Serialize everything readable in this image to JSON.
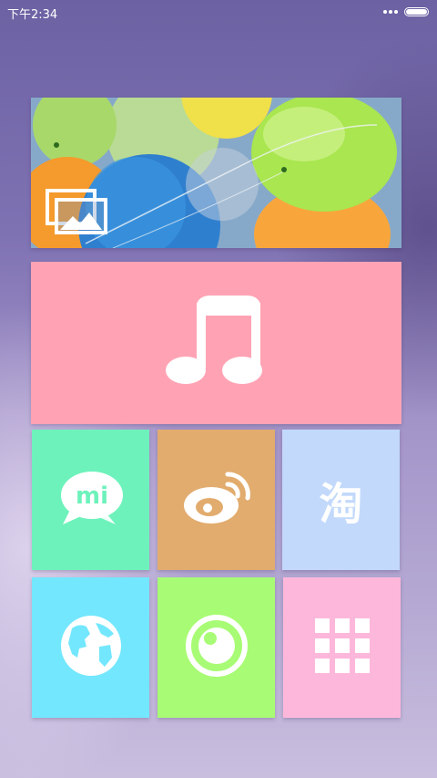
{
  "status_bar": {
    "time": "下午2:34",
    "more_icon": "more-dots-icon",
    "battery_icon": "battery-icon"
  },
  "tiles": [
    {
      "id": "photo",
      "icon": "gallery-icon",
      "color": "#8fb4d0"
    },
    {
      "id": "music",
      "icon": "music-note-icon",
      "color": "#ffa3b4"
    },
    {
      "id": "mi-talk",
      "icon": "mi-chat-icon",
      "text": "mi",
      "color": "#6ef2bc"
    },
    {
      "id": "weibo",
      "icon": "weibo-icon",
      "color": "#e2ac6e"
    },
    {
      "id": "taobao",
      "icon": "taobao-icon",
      "text": "淘",
      "color": "#c2d9fb"
    },
    {
      "id": "browser",
      "icon": "globe-icon",
      "color": "#73e7fd"
    },
    {
      "id": "camera",
      "icon": "camera-icon",
      "color": "#a8fb74"
    },
    {
      "id": "all-apps",
      "icon": "grid-icon",
      "color": "#fdb7da"
    }
  ]
}
